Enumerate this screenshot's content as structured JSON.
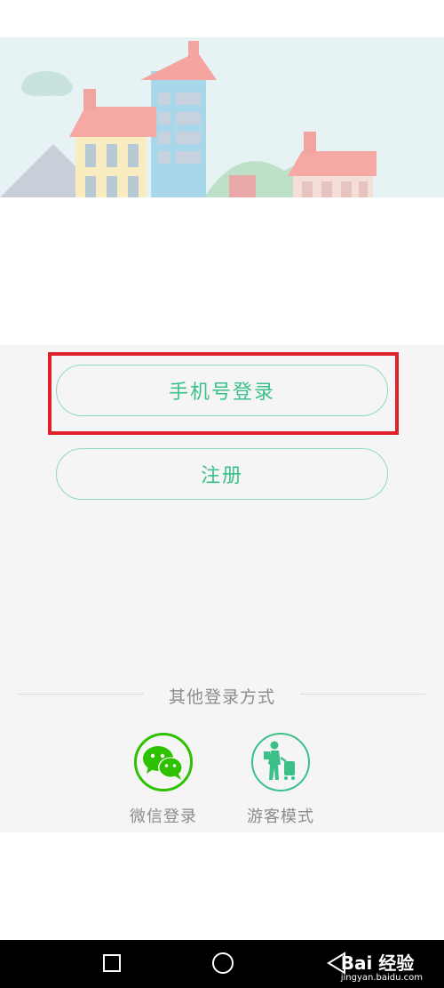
{
  "buttons": {
    "phone_login": "手机号登录",
    "register": "注册"
  },
  "other_login": {
    "title": "其他登录方式",
    "options": [
      {
        "label": "微信登录",
        "icon": "wechat-icon",
        "color": "#2dc100"
      },
      {
        "label": "游客模式",
        "icon": "guest-traveler-icon",
        "color": "#3cc08a"
      }
    ]
  },
  "colors": {
    "accent": "#3cc08a",
    "highlight": "#e0202c"
  },
  "watermark": {
    "brand": "Bai 经验",
    "url": "jingyan.baidu.com"
  }
}
